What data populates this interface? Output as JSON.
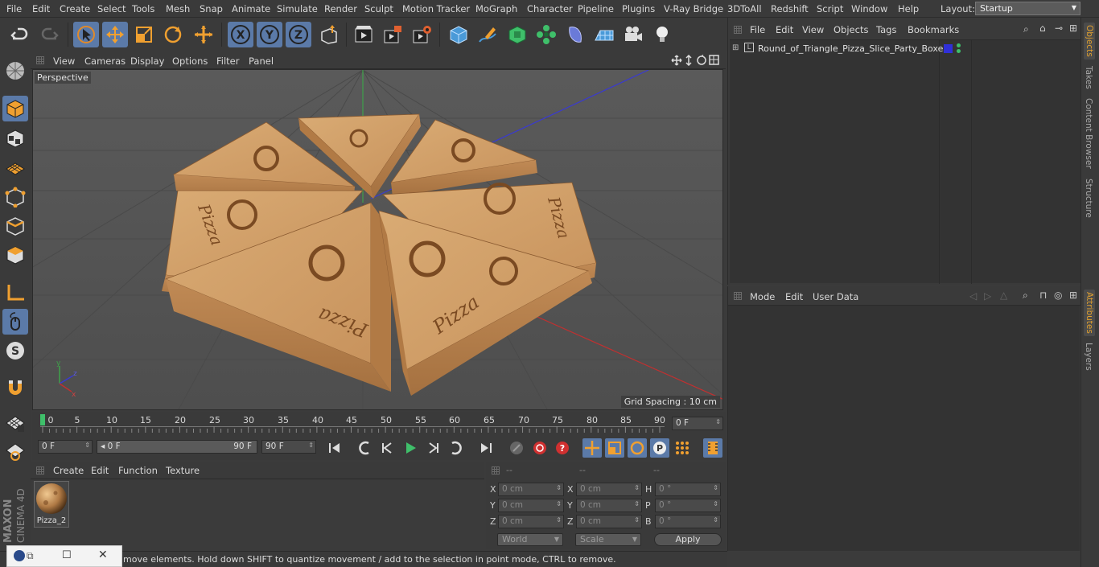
{
  "menubar": {
    "items": [
      "File",
      "Edit",
      "Create",
      "Select",
      "Tools",
      "Mesh",
      "Snap",
      "Animate",
      "Simulate",
      "Render",
      "Sculpt",
      "Motion Tracker",
      "MoGraph",
      "Character",
      "Pipeline",
      "Plugins",
      "V-Ray Bridge",
      "3DToAll",
      "Redshift",
      "Script",
      "Window",
      "Help"
    ],
    "layout_label": "Layout:",
    "layout_value": "Startup"
  },
  "toolbar": {
    "icons": [
      "undo-icon",
      "redo-icon",
      "select-icon",
      "move-icon",
      "scale-icon",
      "rotate-icon",
      "move-alt-icon",
      "x-axis-icon",
      "y-axis-icon",
      "z-axis-icon",
      "coordinate-system-icon",
      "render-view-icon",
      "render-picture-viewer-icon",
      "render-settings-icon",
      "cube-icon",
      "pen-icon",
      "subdivision-icon",
      "cloner-icon",
      "deformer-icon",
      "floor-icon",
      "camera-icon",
      "light-icon"
    ]
  },
  "viewport": {
    "menu": [
      "View",
      "Cameras",
      "Display",
      "Options",
      "Filter",
      "Panel"
    ],
    "label": "Perspective",
    "grid_spacing": "Grid Spacing : 10 cm"
  },
  "timeline": {
    "ticks": [
      "0",
      "5",
      "10",
      "15",
      "20",
      "25",
      "30",
      "35",
      "40",
      "45",
      "50",
      "55",
      "60",
      "65",
      "70",
      "75",
      "80",
      "85",
      "90"
    ],
    "current_frame": "0 F"
  },
  "transport": {
    "start_field": "0 F",
    "range_start": "0 F",
    "range_end": "90 F",
    "end_field": "90 F"
  },
  "materials": {
    "menu": [
      "Create",
      "Edit",
      "Function",
      "Texture"
    ],
    "items": [
      {
        "name": "Pizza_2"
      }
    ]
  },
  "coordinates": {
    "headers": [
      "--",
      "--",
      "--"
    ],
    "rows": [
      {
        "a_label": "X",
        "a_val": "0 cm",
        "b_label": "X",
        "b_val": "0 cm",
        "c_label": "H",
        "c_val": "0 °"
      },
      {
        "a_label": "Y",
        "a_val": "0 cm",
        "b_label": "Y",
        "b_val": "0 cm",
        "c_label": "P",
        "c_val": "0 °"
      },
      {
        "a_label": "Z",
        "a_val": "0 cm",
        "b_label": "Z",
        "b_val": "0 cm",
        "c_label": "B",
        "c_val": "0 °"
      }
    ],
    "mode_world": "World",
    "mode_scale": "Scale",
    "apply": "Apply"
  },
  "objects": {
    "menu": [
      "File",
      "Edit",
      "View",
      "Objects",
      "Tags",
      "Bookmarks"
    ],
    "items": [
      {
        "name": "Round_of_Triangle_Pizza_Slice_Party_Boxes"
      }
    ]
  },
  "attributes": {
    "menu": [
      "Mode",
      "Edit",
      "User Data"
    ]
  },
  "sidetabs": [
    "Objects",
    "Takes",
    "Content Browser",
    "Structure",
    "Attributes",
    "Layers"
  ],
  "status": {
    "text": "move elements. Hold down SHIFT to quantize movement / add to the selection in point mode, CTRL to remove."
  },
  "brand": {
    "line1": "MAXON",
    "line2": "CINEMA 4D"
  },
  "colors": {
    "accent": "#5b7aa8",
    "box": "#d2a06a",
    "box_dark": "#a9713f",
    "print": "#7a4a22",
    "bg": "#3a3a3a",
    "viewport": "#575757"
  }
}
